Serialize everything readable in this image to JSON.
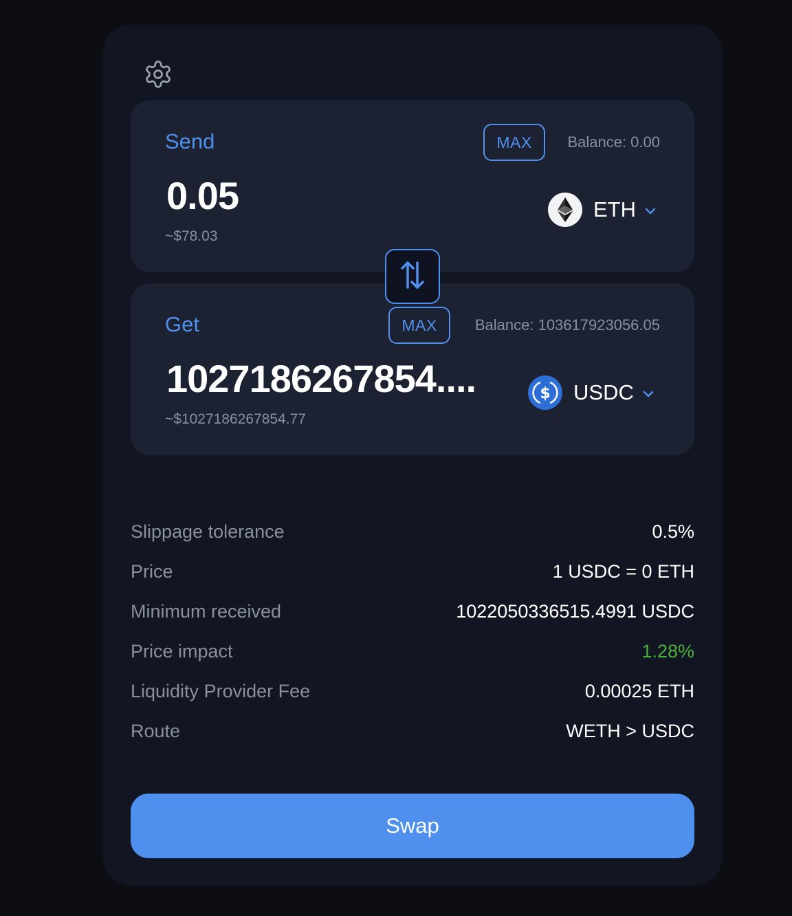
{
  "send": {
    "label": "Send",
    "max_label": "MAX",
    "balance": "Balance: 0.00",
    "amount": "0.05",
    "usd_value": "~$78.03",
    "token": "ETH",
    "token_icon": "ethereum-icon"
  },
  "get": {
    "label": "Get",
    "max_label": "MAX",
    "balance": "Balance: 103617923056.05",
    "amount": "1027186267854....",
    "usd_value": "~$1027186267854.77",
    "token": "USDC",
    "token_icon": "usdc-icon"
  },
  "details": [
    {
      "key": "Slippage tolerance",
      "value": "0.5%"
    },
    {
      "key": "Price",
      "value": "1 USDC = 0 ETH"
    },
    {
      "key": "Minimum received",
      "value": "1022050336515.4991 USDC"
    },
    {
      "key": "Price impact",
      "value": "1.28%"
    },
    {
      "key": "Liquidity Provider Fee",
      "value": "0.00025 ETH"
    },
    {
      "key": "Route",
      "value": "WETH > USDC"
    }
  ],
  "swap_label": "Swap",
  "colors": {
    "accent": "#4f90ee",
    "background": "#0c0e14",
    "card": "#121622",
    "panel": "#1d2232",
    "muted_text": "#8a8f9f",
    "positive": "#4caf3a"
  }
}
